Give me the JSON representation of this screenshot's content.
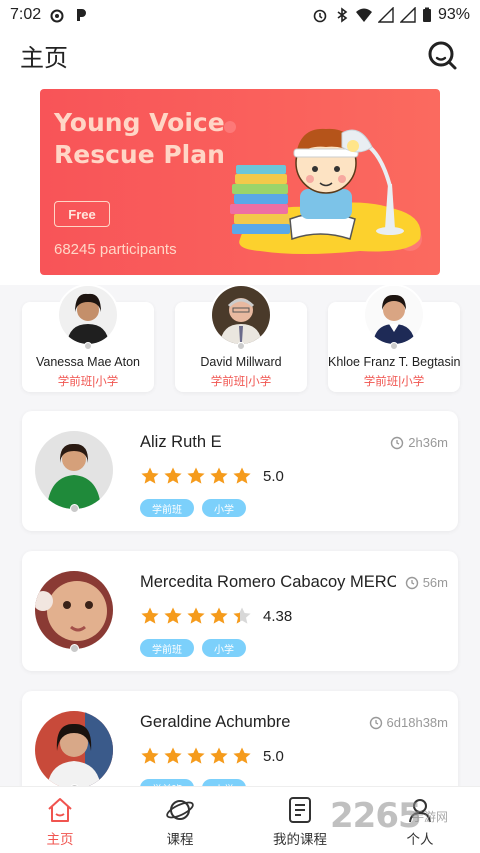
{
  "status_bar": {
    "time": "7:02",
    "battery": "93%",
    "icons": [
      "app-icon-weibo",
      "app-icon-p",
      "alarm-icon",
      "bluetooth-icon",
      "wifi-icon",
      "signal-icon",
      "signal-icon",
      "battery-icon"
    ]
  },
  "header": {
    "title": "主页",
    "search_icon": "search-icon"
  },
  "banner": {
    "title": "Young Voice Rescue Plan",
    "button": "Free",
    "participants": "68245 participants"
  },
  "featured_teachers": [
    {
      "name": "Vanessa Mae Aton",
      "tags": "学前班|小学"
    },
    {
      "name": "David Millward",
      "tags": "学前班|小学"
    },
    {
      "name": "Khloe Franz T. Begtasin",
      "tags": "学前班|小学"
    }
  ],
  "teachers": [
    {
      "name": "Aliz Ruth E",
      "time": "2h36m",
      "rating": "5.0",
      "rating_value": 5.0,
      "tags": [
        "学前班",
        "小学"
      ]
    },
    {
      "name": "Mercedita Romero Cabacoy MERCY",
      "time": "56m",
      "rating": "4.38",
      "rating_value": 4.38,
      "tags": [
        "学前班",
        "小学"
      ]
    },
    {
      "name": "Geraldine Achumbre",
      "time": "6d18h38m",
      "rating": "5.0",
      "rating_value": 5.0,
      "tags": [
        "学前班",
        "小学"
      ]
    }
  ],
  "bottom_nav": [
    {
      "label": "主页",
      "icon": "home-icon",
      "active": true
    },
    {
      "label": "课程",
      "icon": "planet-icon",
      "active": false
    },
    {
      "label": "我的课程",
      "icon": "course-list-icon",
      "active": false
    },
    {
      "label": "个人",
      "icon": "person-icon",
      "active": false
    }
  ],
  "watermark": {
    "text": "2265",
    "sub": "手游网"
  },
  "colors": {
    "accent": "#f0544f",
    "banner": "#f85458",
    "tag": "#7cd0fb",
    "star": "#f59b1c"
  }
}
